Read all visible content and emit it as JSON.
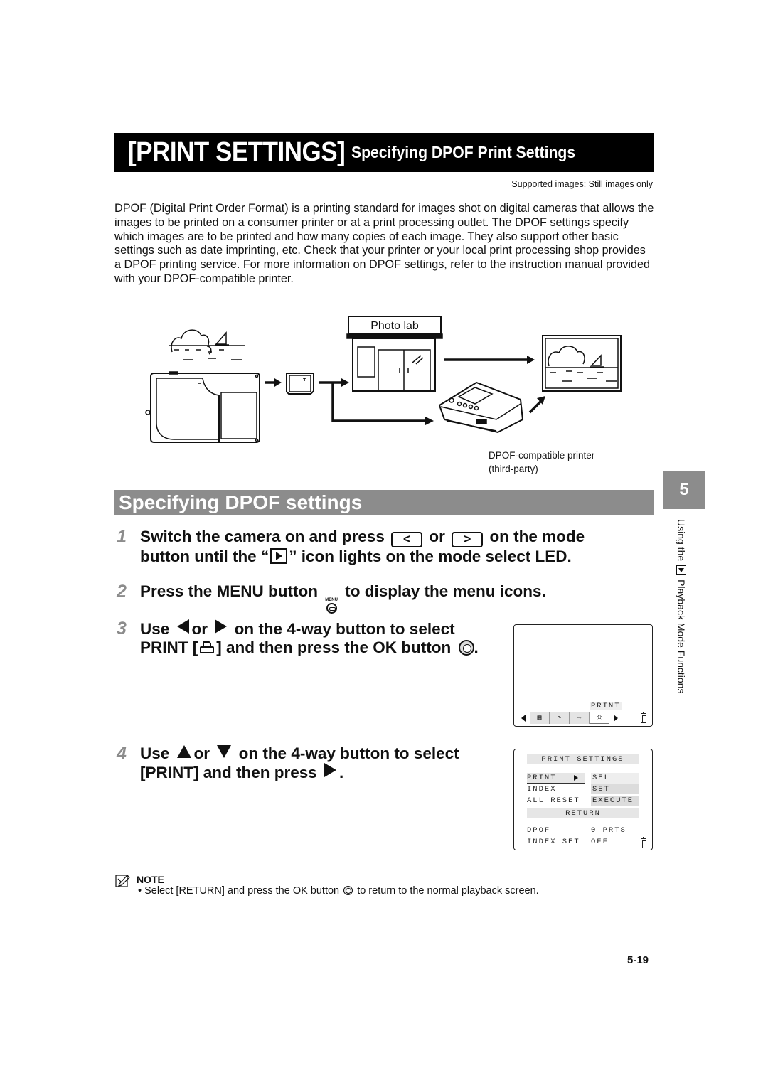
{
  "header": {
    "title_main": "[PRINT SETTINGS]",
    "title_sub": "Specifying DPOF Print Settings",
    "supported_images": "Supported images: Still images only"
  },
  "intro": "DPOF (Digital Print Order Format) is a printing standard for images shot on digital cameras that allows the images to be printed on a consumer printer or at a print processing outlet. The DPOF settings specify which images are to be printed and how many copies of each image. They also support other basic settings such as date imprinting, etc. Check that your printer or your local print processing shop provides a DPOF printing service. For more information on DPOF settings, refer to the instruction manual provided with your DPOF-compatible printer.",
  "diagram": {
    "photolab_label": "Photo lab",
    "printer_caption_line1": "DPOF-compatible printer",
    "printer_caption_line2": "(third-party)"
  },
  "section": {
    "title": "Specifying DPOF settings"
  },
  "chapter": {
    "number": "5",
    "side_text_before": "Using the",
    "side_text_after": "Playback Mode Functions"
  },
  "steps": [
    {
      "number": "1",
      "line1_a": "Switch the camera on and press",
      "key_left": "<",
      "or": "or",
      "key_right": ">",
      "line1_b": "on the mode",
      "line2_a": "button until the “",
      "line2_b": "” icon lights on the mode select LED."
    },
    {
      "number": "2",
      "text_a": "Press the MENU button",
      "menu_label": "MENU",
      "text_b": "to display the menu icons."
    },
    {
      "number": "3",
      "line1_a": "Use",
      "or": "or",
      "line1_b": "on the 4-way button to select",
      "line2_a": "PRINT [",
      "line2_b": "] and then press the OK button",
      "line2_c": "."
    },
    {
      "number": "4",
      "line1_a": "Use",
      "or": "or",
      "line1_b": "on the 4-way button to select",
      "line2_a": "[PRINT] and then press",
      "line2_b": "."
    }
  ],
  "lcd_menu_icons": {
    "selected_label": "PRINT",
    "icons": [
      "thumbnail-icon",
      "rotate-icon",
      "slideshow-icon",
      "print-icon"
    ]
  },
  "lcd_print_settings": {
    "header": "PRINT SETTINGS",
    "rows": [
      {
        "label": "PRINT",
        "value": "SEL IMAGE"
      },
      {
        "label": "INDEX",
        "value": "SET"
      },
      {
        "label": "ALL RESET",
        "value": "EXECUTE"
      }
    ],
    "return": "RETURN",
    "info": [
      {
        "label": "DPOF",
        "value": "0 PRTS"
      },
      {
        "label": "INDEX SET",
        "value": "OFF"
      }
    ]
  },
  "note": {
    "label": "NOTE",
    "text_a": "• Select [RETURN] and press the OK button",
    "text_b": "to return to the normal playback screen."
  },
  "page_number": "5-19"
}
